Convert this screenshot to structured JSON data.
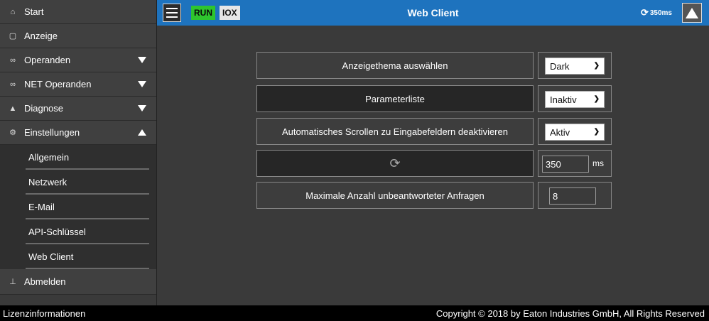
{
  "sidebar": {
    "items": [
      {
        "label": "Start",
        "icon": "home-icon"
      },
      {
        "label": "Anzeige",
        "icon": "monitor-icon"
      },
      {
        "label": "Operanden",
        "icon": "link-icon"
      },
      {
        "label": "NET Operanden",
        "icon": "link-icon"
      },
      {
        "label": "Diagnose",
        "icon": "warning-icon"
      },
      {
        "label": "Einstellungen",
        "icon": "gear-icon"
      }
    ],
    "subitems": [
      {
        "label": "Allgemein"
      },
      {
        "label": "Netzwerk"
      },
      {
        "label": "E-Mail"
      },
      {
        "label": "API-Schlüssel"
      },
      {
        "label": "Web Client"
      }
    ],
    "logout": {
      "label": "Abmelden",
      "icon": "logout-icon"
    }
  },
  "topbar": {
    "title": "Web Client",
    "run_badge": "RUN",
    "iox_badge": "IOX",
    "cycle_time": "350ms",
    "accent_color": "#1e73be"
  },
  "settings": {
    "theme": {
      "label": "Anzeigethema auswählen",
      "value": "Dark"
    },
    "paramlist": {
      "label": "Parameterliste",
      "value": "Inaktiv"
    },
    "autoscroll": {
      "label": "Automatisches Scrollen zu Eingabefeldern deaktivieren",
      "value": "Aktiv"
    },
    "refresh": {
      "value": "350",
      "unit": "ms"
    },
    "maxrequests": {
      "label": "Maximale Anzahl unbeantworteter Anfragen",
      "value": "8"
    }
  },
  "footer": {
    "license": "Lizenzinformationen",
    "copyright": "Copyright © 2018 by Eaton Industries GmbH, All Rights Reserved"
  }
}
